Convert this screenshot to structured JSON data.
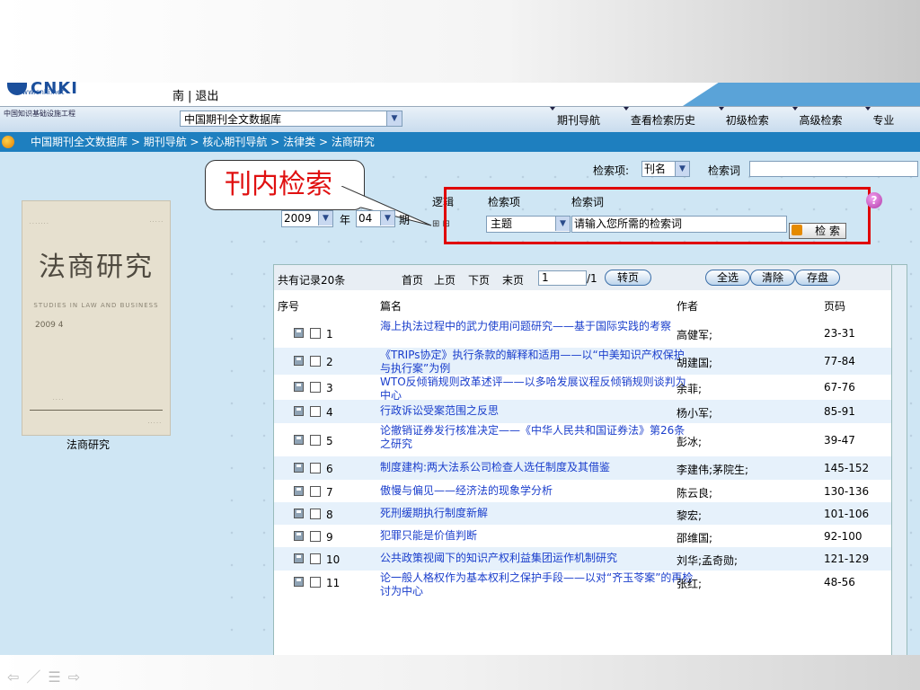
{
  "header": {
    "logo_text": "CNKI",
    "logo_url": "www.cnki.net",
    "top_links": [
      "南",
      "退出"
    ],
    "project_tag": "中国知识基础设施工程"
  },
  "nav": {
    "database_select": "中国期刊全文数据库",
    "links": [
      "期刊导航",
      "查看检索历史",
      "初级检索",
      "高级检索",
      "专业"
    ]
  },
  "breadcrumb": [
    "中国期刊全文数据库",
    "期刊导航",
    "核心期刊导航",
    "法律类",
    "法商研究"
  ],
  "callout": {
    "text": "刊内检索"
  },
  "top_search": {
    "label_field": "检索项:",
    "field_value": "刊名",
    "label_keyword": "检索词",
    "keyword_value": ""
  },
  "inner_search": {
    "headers": [
      "逻辑",
      "检索项",
      "检索词"
    ],
    "field_value": "主题",
    "keyword_placeholder": "请输入您所需的检索词",
    "button_label": "检 索"
  },
  "issue": {
    "year": "2009",
    "year_word": "年",
    "issue": "04",
    "issue_word": "期"
  },
  "cover": {
    "title": "法商研究",
    "english": "STUDIES IN LAW AND BUSINESS",
    "year": "2009  4",
    "caption": "法商研究"
  },
  "pager": {
    "total": "共有记录20条",
    "first": "首页",
    "prev": "上页",
    "next": "下页",
    "last": "末页",
    "page_value": "1",
    "page_total": "/1",
    "goto": "转页",
    "select_all": "全选",
    "clear": "清除",
    "save": "存盘"
  },
  "columns": [
    "序号",
    "篇名",
    "作者",
    "页码"
  ],
  "rows": [
    {
      "no": "1",
      "title": "海上执法过程中的武力使用问题研究——基于国际实践的考察",
      "author": "高健军;",
      "pages": "23-31"
    },
    {
      "no": "2",
      "title": "《TRIPs协定》执行条款的解释和适用——以“中美知识产权保护与执行案”为例",
      "author": "胡建国;",
      "pages": "77-84"
    },
    {
      "no": "3",
      "title": "WTO反倾销规则改革述评——以多哈发展议程反倾销规则谈判为中心",
      "author": "余菲;",
      "pages": "67-76"
    },
    {
      "no": "4",
      "title": "行政诉讼受案范围之反思",
      "author": "杨小军;",
      "pages": "85-91"
    },
    {
      "no": "5",
      "title": "论撤销证券发行核准决定——《中华人民共和国证券法》第26条之研究",
      "author": "彭冰;",
      "pages": "39-47"
    },
    {
      "no": "6",
      "title": "制度建构:两大法系公司检查人选任制度及其借鉴",
      "author": "李建伟;茅院生;",
      "pages": "145-152"
    },
    {
      "no": "7",
      "title": "傲慢与偏见——经济法的现象学分析",
      "author": "陈云良;",
      "pages": "130-136"
    },
    {
      "no": "8",
      "title": "死刑缓期执行制度新解",
      "author": "黎宏;",
      "pages": "101-106"
    },
    {
      "no": "9",
      "title": "犯罪只能是价值判断",
      "author": "邵维国;",
      "pages": "92-100"
    },
    {
      "no": "10",
      "title": "公共政策视阈下的知识产权利益集团运作机制研究",
      "author": "刘华;孟奇勋;",
      "pages": "121-129"
    },
    {
      "no": "11",
      "title": "论一般人格权作为基本权利之保护手段——以对“齐玉苓案”的再检讨为中心",
      "author": "张红;",
      "pages": "48-56"
    }
  ]
}
